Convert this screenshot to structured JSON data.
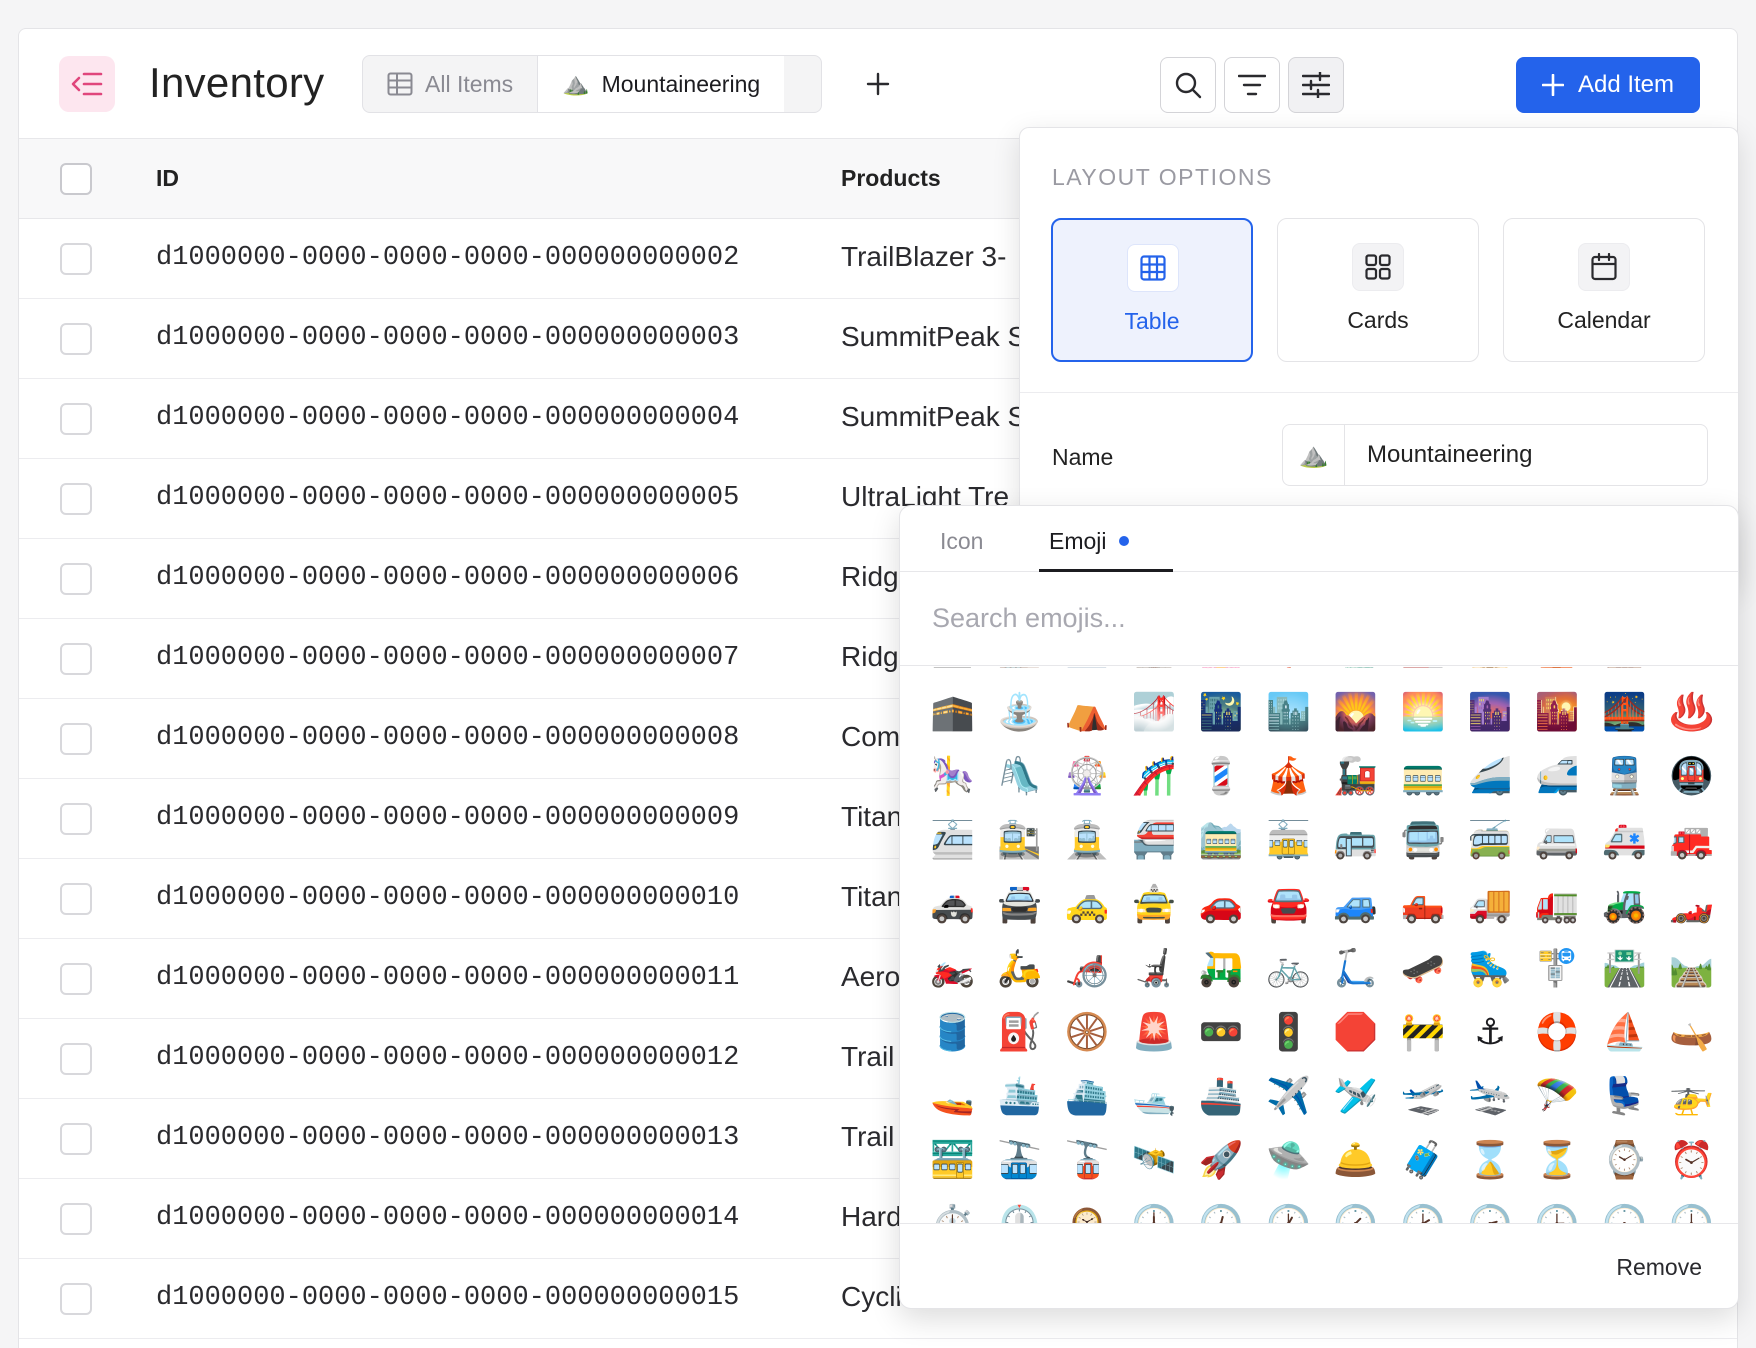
{
  "app": {
    "title": "Inventory"
  },
  "tabs": [
    {
      "label": "All Items",
      "icon": "table-icon",
      "active": false
    },
    {
      "label": "Mountaineering",
      "icon": "⛰️",
      "active": true
    }
  ],
  "toolbar": {
    "add_label": "Add Item"
  },
  "colors": {
    "accent": "#2463eb",
    "logo_bg": "#fde6ef",
    "logo_fg": "#e0467c"
  },
  "table": {
    "columns": [
      "ID",
      "Products"
    ],
    "rows": [
      {
        "id": "d1000000-0000-0000-0000-000000000002",
        "product": "TrailBlazer 3-"
      },
      {
        "id": "d1000000-0000-0000-0000-000000000003",
        "product": "SummitPeak S"
      },
      {
        "id": "d1000000-0000-0000-0000-000000000004",
        "product": "SummitPeak S"
      },
      {
        "id": "d1000000-0000-0000-0000-000000000005",
        "product": "UltraLight Tre"
      },
      {
        "id": "d1000000-0000-0000-0000-000000000006",
        "product": "Ridg"
      },
      {
        "id": "d1000000-0000-0000-0000-000000000007",
        "product": "Ridg"
      },
      {
        "id": "d1000000-0000-0000-0000-000000000008",
        "product": "Com"
      },
      {
        "id": "d1000000-0000-0000-0000-000000000009",
        "product": "Titan"
      },
      {
        "id": "d1000000-0000-0000-0000-000000000010",
        "product": "Titan"
      },
      {
        "id": "d1000000-0000-0000-0000-000000000011",
        "product": "Aero"
      },
      {
        "id": "d1000000-0000-0000-0000-000000000012",
        "product": "Trail"
      },
      {
        "id": "d1000000-0000-0000-0000-000000000013",
        "product": "Trail"
      },
      {
        "id": "d1000000-0000-0000-0000-000000000014",
        "product": "Hard"
      },
      {
        "id": "d1000000-0000-0000-0000-000000000015",
        "product": "Cycli"
      }
    ]
  },
  "layout_panel": {
    "title": "LAYOUT OPTIONS",
    "options": [
      {
        "label": "Table",
        "icon": "table-icon",
        "selected": true
      },
      {
        "label": "Cards",
        "icon": "cards-icon",
        "selected": false
      },
      {
        "label": "Calendar",
        "icon": "calendar-icon",
        "selected": false
      }
    ],
    "name_label": "Name",
    "name_emoji": "⛰️",
    "name_value": "Mountaineering"
  },
  "emoji_picker": {
    "tabs": [
      "Icon",
      "Emoji"
    ],
    "active_tab": "Emoji",
    "search_placeholder": "Search emojis...",
    "remove_label": "Remove",
    "emojis": [
      "🏢",
      "🏬",
      "🏛️",
      "🏰",
      "🏩",
      "🗼",
      "🗽",
      "🏭",
      "🕌",
      "🛕",
      "🕍",
      "⛩️",
      "🕋",
      "⛲",
      "⛺",
      "🌁",
      "🌃",
      "🏙️",
      "🌄",
      "🌅",
      "🌆",
      "🌇",
      "🌉",
      "♨️",
      "🎠",
      "🛝",
      "🎡",
      "🎢",
      "💈",
      "🎪",
      "🚂",
      "🚃",
      "🚄",
      "🚅",
      "🚆",
      "🚇",
      "🚈",
      "🚉",
      "🚊",
      "🚝",
      "🚞",
      "🚋",
      "🚌",
      "🚍",
      "🚎",
      "🚐",
      "🚑",
      "🚒",
      "🚓",
      "🚔",
      "🚕",
      "🚖",
      "🚗",
      "🚘",
      "🚙",
      "🛻",
      "🚚",
      "🚛",
      "🚜",
      "🏎️",
      "🏍️",
      "🛵",
      "🦽",
      "🦼",
      "🛺",
      "🚲",
      "🛴",
      "🛹",
      "🛼",
      "🚏",
      "🛣️",
      "🛤️",
      "🛢️",
      "⛽",
      "🛞",
      "🚨",
      "🚥",
      "🚦",
      "🛑",
      "🚧",
      "⚓",
      "🛟",
      "⛵",
      "🛶",
      "🚤",
      "🛳️",
      "⛴️",
      "🛥️",
      "🚢",
      "✈️",
      "🛩️",
      "🛫",
      "🛬",
      "🪂",
      "💺",
      "🚁",
      "🚟",
      "🚠",
      "🚡",
      "🛰️",
      "🚀",
      "🛸",
      "🛎️",
      "🧳",
      "⌛",
      "⏳",
      "⌚",
      "⏰",
      "⏱️",
      "⏲️",
      "🕰️",
      "🕛",
      "🕧",
      "🕐",
      "🕜",
      "🕑",
      "🕝",
      "🕒",
      "🕞",
      "🕓"
    ]
  }
}
